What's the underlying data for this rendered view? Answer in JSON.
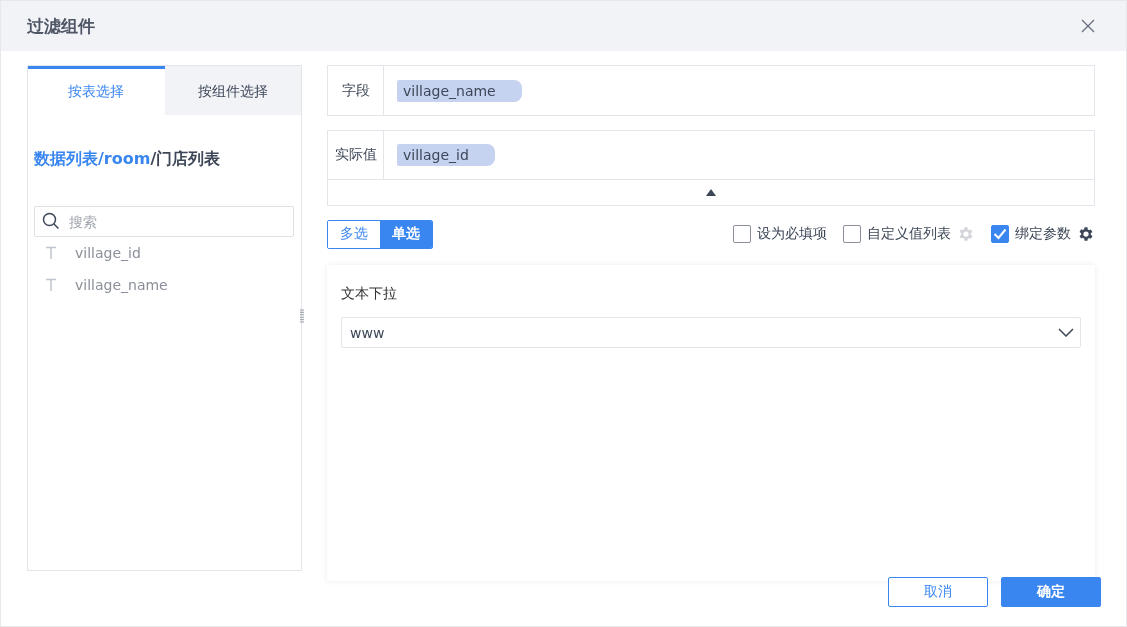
{
  "window": {
    "title": "过滤组件"
  },
  "tabs": [
    {
      "label": "按表选择",
      "selected": true
    },
    {
      "label": "按组件选择",
      "selected": false
    }
  ],
  "breadcrumb": [
    {
      "text": "数据列表/room",
      "kind": "link"
    },
    {
      "text": "/门店列表",
      "kind": "current"
    }
  ],
  "search": {
    "placeholder": "搜索"
  },
  "fields": [
    {
      "name": "village_id"
    },
    {
      "name": "village_name"
    }
  ],
  "bindings": [
    {
      "label": "字段",
      "value": "village_name"
    },
    {
      "label": "实际值",
      "value": "village_id"
    }
  ],
  "expanded": true,
  "modes": [
    {
      "label": "多选",
      "selected": false
    },
    {
      "label": "单选",
      "selected": true
    }
  ],
  "options": [
    {
      "label": "设为必填项",
      "checked": false
    },
    {
      "label": "自定义值列表",
      "checked": false,
      "settings_enabled": false
    },
    {
      "label": "绑定参数",
      "checked": true,
      "settings_enabled": true
    }
  ],
  "preview": {
    "title": "文本下拉",
    "value": "www"
  },
  "buttons": [
    {
      "label": "取消",
      "kind": "secondary"
    },
    {
      "label": "确定",
      "kind": "primary"
    }
  ]
}
